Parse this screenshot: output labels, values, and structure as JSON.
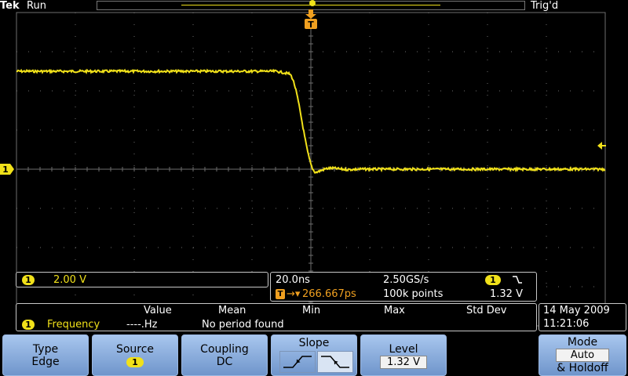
{
  "header": {
    "brand": "Tek",
    "acq_state": "Run",
    "trig_state": "Trig'd"
  },
  "channel1": {
    "marker": "1",
    "scale": "2.00 V"
  },
  "timebase": {
    "time_per_div": "20.0ns",
    "sample_rate": "2.50GS/s",
    "trigger_position": "266.667ps",
    "record_length": "100k points",
    "trigger_source": "1",
    "trigger_level": "1.32 V"
  },
  "measurements": {
    "headers": [
      "Value",
      "Mean",
      "Min",
      "Max",
      "Std Dev"
    ],
    "rows": [
      {
        "source": "1",
        "name": "Frequency",
        "value": "----.Hz",
        "message": "No period found"
      }
    ]
  },
  "datetime": {
    "date": "14 May 2009",
    "time": "11:21:06"
  },
  "menu": {
    "type": {
      "label": "Type",
      "value": "Edge"
    },
    "source": {
      "label": "Source",
      "value": "1"
    },
    "coupling": {
      "label": "Coupling",
      "value": "DC"
    },
    "slope": {
      "label": "Slope",
      "selected": "falling"
    },
    "level": {
      "label": "Level",
      "value": "1.32 V"
    },
    "mode": {
      "label": "Mode",
      "value": "Auto",
      "extra": "& Holdoff"
    }
  },
  "markers": {
    "trigger_flag": "T",
    "trigger_position": "T"
  },
  "colors": {
    "trace": "#f1e11a",
    "grid": "#6e6e6e",
    "menu": "#8fb1e2"
  },
  "waveform": {
    "high_level_div": 1.0,
    "low_level_div": 0.0,
    "edge_time_div": 0.02
  }
}
